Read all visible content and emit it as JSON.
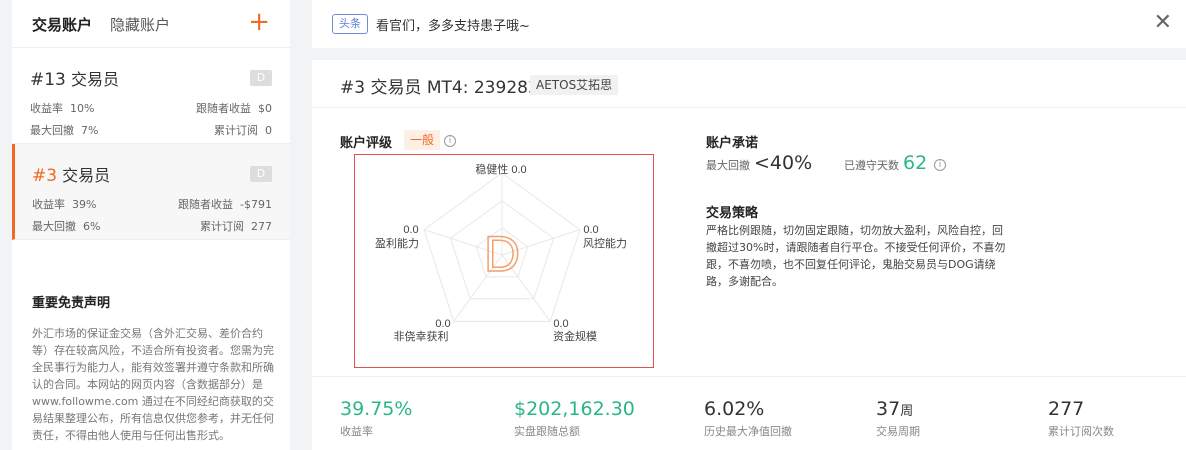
{
  "sidebar": {
    "tab_active": "交易账户",
    "tab_inactive": "隐藏账户",
    "add_icon": "plus-icon",
    "accounts": [
      {
        "num": "#13",
        "role": "交易员",
        "level": "D",
        "return_label": "收益率",
        "return_value": "10%",
        "follower_label": "跟随者收益",
        "follower_value": "$0",
        "drawdown_label": "最大回撤",
        "drawdown_value": "7%",
        "subs_label": "累计订阅",
        "subs_value": "0"
      },
      {
        "num": "#3",
        "role": "交易员",
        "level": "D",
        "return_label": "收益率",
        "return_value": "39%",
        "follower_label": "跟随者收益",
        "follower_value": "-$791",
        "drawdown_label": "最大回撤",
        "drawdown_value": "6%",
        "subs_label": "累计订阅",
        "subs_value": "277"
      }
    ],
    "disclaimer_title": "重要免责声明",
    "disclaimer_text": "外汇市场的保证金交易（含外汇交易、差价合约等）存在较高风险，不适合所有投资者。您需为完全民事行为能力人，能有效签署并遵守条款和所确认的合同。本网站的网页内容（含数据部分）是 www.followme.com 通过在不同经纪商获取的交易结果整理公布，所有信息仅供您参考，并无任何责任，不得由他人使用与任何出售形式。"
  },
  "notice": {
    "tag": "头条",
    "text": "看官们，多多支持患子哦~",
    "close_icon": "close-icon"
  },
  "header": {
    "title": "#3 交易员 MT4: 239283",
    "broker": "AETOS艾拓思"
  },
  "rating": {
    "label": "账户评级",
    "badge": "一般",
    "grade": "D",
    "axes": [
      {
        "name": "稳健性",
        "value": "0.0"
      },
      {
        "name": "风控能力",
        "value": "0.0"
      },
      {
        "name": "资金规模",
        "value": "0.0"
      },
      {
        "name": "非侥幸获利",
        "value": "0.0"
      },
      {
        "name": "盈利能力",
        "value": "0.0"
      }
    ]
  },
  "commitment": {
    "title": "账户承诺",
    "drawdown_label": "最大回撤",
    "drawdown_value": "<40%",
    "days_label": "已遵守天数",
    "days_value": "62"
  },
  "strategy": {
    "title": "交易策略",
    "text": "严格比例跟随，切勿固定跟随，切勿放大盈利，风险自控，回撤超过30%时，请跟随者自行平仓。不接受任何评价，不喜勿跟，不喜勿喷，也不回复任何评论，鬼胎交易员与DOG请绕路，多谢配合。"
  },
  "stats": [
    {
      "value": "39.75%",
      "unit": "",
      "label": "收益率"
    },
    {
      "value": "$202,162.30",
      "unit": "",
      "label": "实盘跟随总额"
    },
    {
      "value": "6.02%",
      "unit": "",
      "label": "历史最大净值回撤"
    },
    {
      "value": "37",
      "unit": "周",
      "label": "交易周期"
    },
    {
      "value": "277",
      "unit": "",
      "label": "累计订阅次数"
    }
  ],
  "colors": {
    "accent": "#f06a25",
    "green": "#2bb68a",
    "border_red": "#e0544a"
  }
}
